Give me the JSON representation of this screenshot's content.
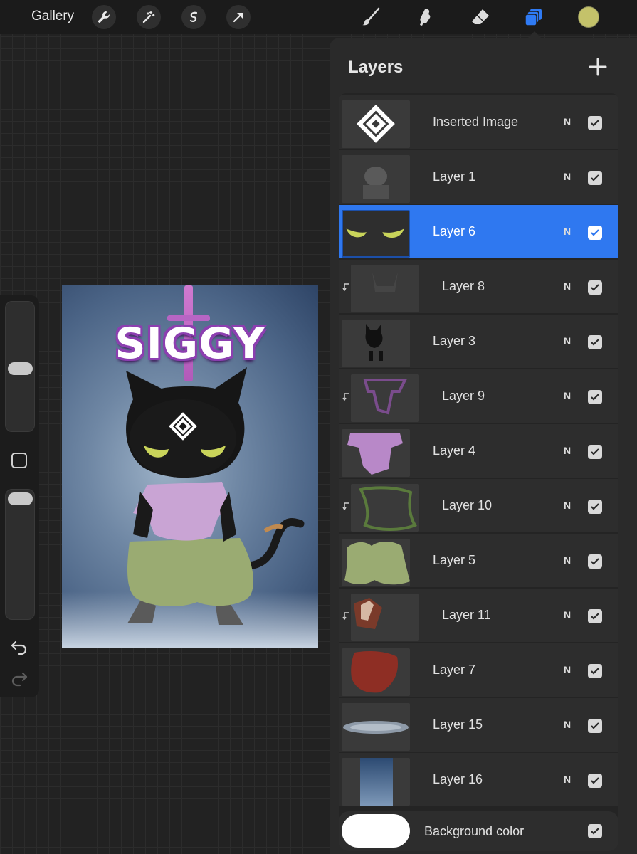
{
  "topbar": {
    "gallery_label": "Gallery",
    "tools_left": [
      "wrench-icon",
      "magic-wand-icon",
      "selection-icon",
      "transform-arrow-icon"
    ],
    "tools_right": [
      "brush-icon",
      "smudge-icon",
      "eraser-icon",
      "layers-icon"
    ],
    "current_color": "#c4c26a",
    "active_tool_color": "#2f7bf5"
  },
  "sidebar": {
    "brush_size_slider": 0.47,
    "opacity_slider": 0.92,
    "modify_button": "square-icon",
    "undo": "undo-icon",
    "redo": "redo-icon"
  },
  "canvas": {
    "artwork_title": "SIGGY"
  },
  "layers_panel": {
    "title": "Layers",
    "add_button": "plus-icon",
    "layers": [
      {
        "name": "Inserted Image",
        "blend": "N",
        "visible": true,
        "clipped": false,
        "selected": false
      },
      {
        "name": "Layer 1",
        "blend": "N",
        "visible": true,
        "clipped": false,
        "selected": false
      },
      {
        "name": "Layer 6",
        "blend": "N",
        "visible": true,
        "clipped": false,
        "selected": true
      },
      {
        "name": "Layer 8",
        "blend": "N",
        "visible": true,
        "clipped": true,
        "selected": false
      },
      {
        "name": "Layer 3",
        "blend": "N",
        "visible": true,
        "clipped": false,
        "selected": false
      },
      {
        "name": "Layer 9",
        "blend": "N",
        "visible": true,
        "clipped": true,
        "selected": false
      },
      {
        "name": "Layer 4",
        "blend": "N",
        "visible": true,
        "clipped": false,
        "selected": false
      },
      {
        "name": "Layer 10",
        "blend": "N",
        "visible": true,
        "clipped": true,
        "selected": false
      },
      {
        "name": "Layer 5",
        "blend": "N",
        "visible": true,
        "clipped": false,
        "selected": false
      },
      {
        "name": "Layer 11",
        "blend": "N",
        "visible": true,
        "clipped": true,
        "selected": false
      },
      {
        "name": "Layer 7",
        "blend": "N",
        "visible": true,
        "clipped": false,
        "selected": false
      },
      {
        "name": "Layer 15",
        "blend": "N",
        "visible": true,
        "clipped": false,
        "selected": false
      },
      {
        "name": "Layer 16",
        "blend": "N",
        "visible": true,
        "clipped": false,
        "selected": false
      }
    ],
    "background": {
      "label": "Background color",
      "color": "#ffffff",
      "visible": true
    }
  }
}
